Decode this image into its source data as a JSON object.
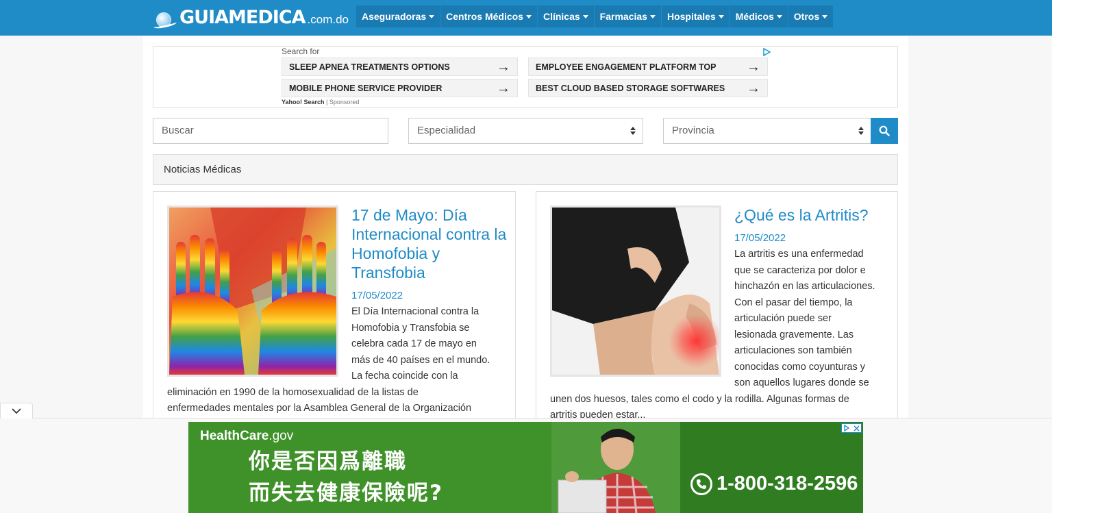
{
  "header": {
    "brand": "GUIAMEDICA",
    "tld": ".com.do",
    "nav": [
      "Aseguradoras",
      "Centros Médicos",
      "Clínicas",
      "Farmacias",
      "Hospitales",
      "Médicos",
      "Otros"
    ]
  },
  "ad_top": {
    "search_for": "Search for",
    "links": [
      "SLEEP APNEA TREATMENTS OPTIONS",
      "EMPLOYEE ENGAGEMENT PLATFORM TOP",
      "MOBILE PHONE SERVICE PROVIDER",
      "BEST CLOUD BASED STORAGE SOFTWARES"
    ],
    "arrow": "→",
    "yahoo_brand": "Yahoo! Search",
    "separator": " | ",
    "sponsored": "Sponsored"
  },
  "search": {
    "query_placeholder": "Buscar",
    "specialty_value": "Especialidad",
    "province_value": "Provincia"
  },
  "news": {
    "header": "Noticias Médicas",
    "articles": [
      {
        "title": "17 de Mayo: Día Internacional contra la Homofobia y Transfobia",
        "date": "17/05/2022",
        "excerpt_lines": [
          "El Día Internacional contra la",
          "Homofobia y Transfobia se",
          "celebra cada 17 de mayo en",
          "más de 40 países en el mundo.",
          "La fecha coincide con la",
          "eliminación en 1990 de la homosexualidad de la listas de",
          "enfermedades mentales por la Asamblea General de la Organización"
        ]
      },
      {
        "title": "¿Qué es la Artritis?",
        "date": "17/05/2022",
        "excerpt_lines": [
          "La artritis es una enfermedad",
          "que se caracteriza por dolor e",
          "hinchazón en las articulaciones.",
          "Con el pasar del tiempo, la",
          "articulación puede ser",
          "lesionada gravemente. Las",
          "articulaciones son también",
          "conocidas como coyunturas y",
          "son aquellos lugares donde se",
          "unen dos huesos, tales como el codo y la rodilla. Algunas formas de",
          "artritis pueden estar..."
        ]
      }
    ]
  },
  "bottom_ad": {
    "brand": "HealthCare",
    "brand_suffix": ".gov",
    "line1": "你是否因爲離職",
    "line2": "而失去健康保險呢?",
    "phone": "1-800-318-2596"
  },
  "colors": {
    "brand_blue": "#1f8bc7",
    "ad_green": "#3a8a27"
  }
}
